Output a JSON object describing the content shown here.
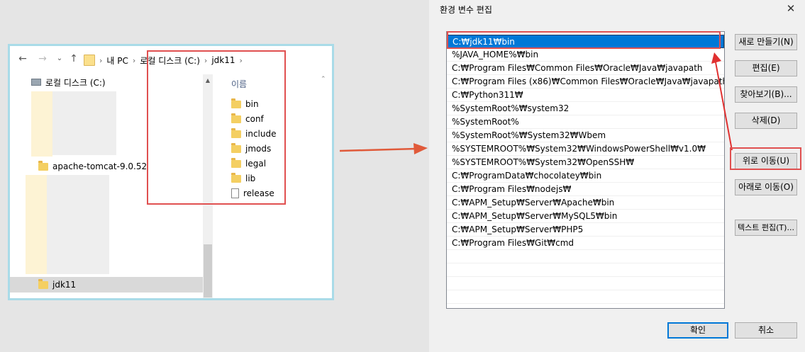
{
  "explorer": {
    "breadcrumb": [
      "내 PC",
      "로컬 디스크 (C:)",
      "jdk11"
    ],
    "tree": {
      "drive_label": "로컬 디스크 (C:)",
      "items": [
        "apache-tomcat-9.0.52",
        "jdk11"
      ]
    },
    "column_header": "이름",
    "files": [
      {
        "name": "bin",
        "type": "folder"
      },
      {
        "name": "conf",
        "type": "folder"
      },
      {
        "name": "include",
        "type": "folder"
      },
      {
        "name": "jmods",
        "type": "folder"
      },
      {
        "name": "legal",
        "type": "folder"
      },
      {
        "name": "lib",
        "type": "folder"
      },
      {
        "name": "release",
        "type": "file"
      }
    ]
  },
  "dialog": {
    "title": "환경 변수 편집",
    "entries": [
      "C:₩jdk11₩bin",
      "%JAVA_HOME%₩bin",
      "C:₩Program Files₩Common Files₩Oracle₩Java₩javapath",
      "C:₩Program Files (x86)₩Common Files₩Oracle₩Java₩javapath",
      "C:₩Python311₩",
      "%SystemRoot%₩system32",
      "%SystemRoot%",
      "%SystemRoot%₩System32₩Wbem",
      "%SYSTEMROOT%₩System32₩WindowsPowerShell₩v1.0₩",
      "%SYSTEMROOT%₩System32₩OpenSSH₩",
      "C:₩ProgramData₩chocolatey₩bin",
      "C:₩Program Files₩nodejs₩",
      "C:₩APM_Setup₩Server₩Apache₩bin",
      "C:₩APM_Setup₩Server₩MySQL5₩bin",
      "C:₩APM_Setup₩Server₩PHP5",
      "C:₩Program Files₩Git₩cmd"
    ],
    "selected_index": 0,
    "buttons": {
      "new": "새로 만들기(N)",
      "edit": "편집(E)",
      "browse": "찾아보기(B)...",
      "delete": "삭제(D)",
      "move_up": "위로 이동(U)",
      "move_down": "아래로 이동(O)",
      "edit_text": "텍스트 편집(T)...",
      "ok": "확인",
      "cancel": "취소"
    }
  },
  "colors": {
    "highlight": "#e03030",
    "selection": "#0078d7",
    "explorer_border": "#a9dbe8"
  }
}
